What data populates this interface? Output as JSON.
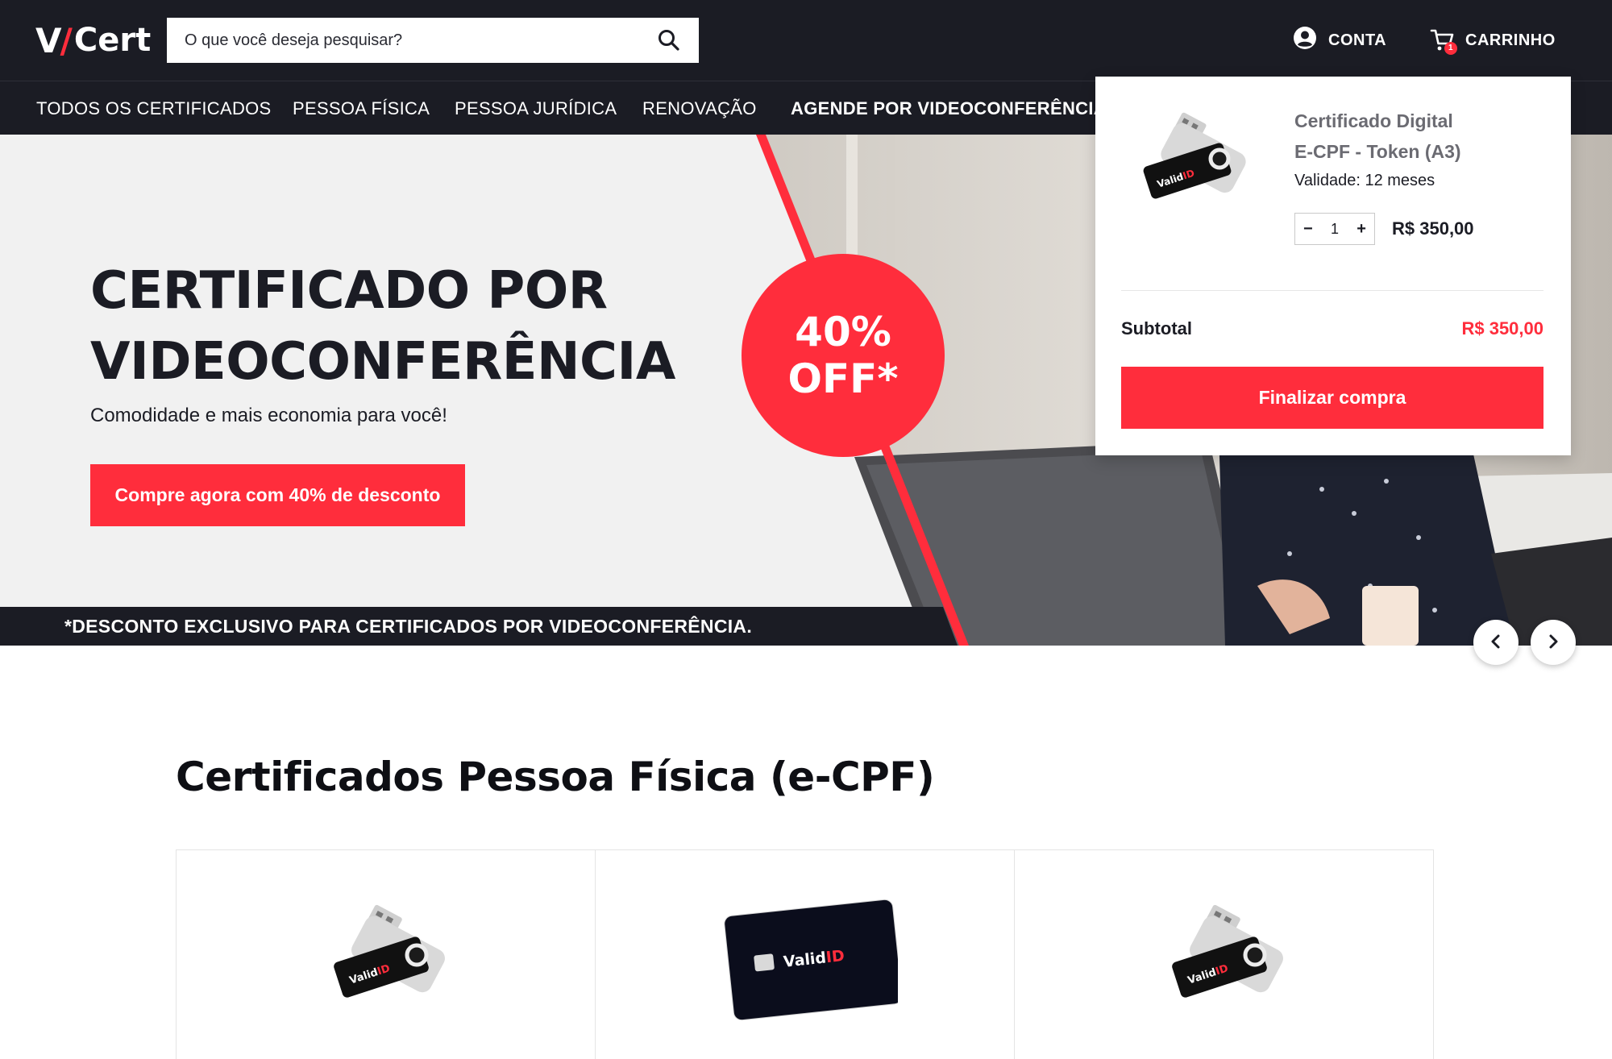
{
  "header": {
    "logo": {
      "v": "V",
      "slash": "/",
      "cert": "Cert"
    },
    "search": {
      "placeholder": "O que você deseja pesquisar?",
      "icon": "search-icon"
    },
    "account_label": "CONTA",
    "cart_label": "CARRINHO",
    "cart_count": "1"
  },
  "nav": {
    "items": [
      {
        "label": "TODOS OS CERTIFICADOS"
      },
      {
        "label": "PESSOA FÍSICA"
      },
      {
        "label": "PESSOA JURÍDICA"
      },
      {
        "label": "RENOVAÇÃO"
      },
      {
        "label": "AGENDE POR VIDEOCONFERÊNCIA"
      }
    ]
  },
  "hero": {
    "title_line1": "CERTIFICADO POR",
    "title_line2": "VIDEOCONFERÊNCIA",
    "subtitle": "Comodidade e mais economia para você!",
    "cta": "Compre agora com 40% de desconto",
    "badge_line1": "40%",
    "badge_line2": "OFF*",
    "disclaimer": "*DESCONTO EXCLUSIVO PARA CERTIFICADOS POR VIDEOCONFERÊNCIA."
  },
  "carousel": {
    "prev_icon": "chevron-left-icon",
    "next_icon": "chevron-right-icon"
  },
  "section": {
    "title": "Certificados Pessoa Física (e-CPF)"
  },
  "cart_dropdown": {
    "product_name_line1": "Certificado Digital",
    "product_name_line2": "E-CPF - Token (A3)",
    "validity": "Validade: 12 meses",
    "quantity": "1",
    "price": "R$ 350,00",
    "subtotal_label": "Subtotal",
    "subtotal_value": "R$ 350,00",
    "checkout_label": "Finalizar compra"
  },
  "product_images": {
    "token_brand": "ValidID",
    "card_brand": "ValidID"
  },
  "colors": {
    "accent": "#ff2d3c",
    "dark": "#1b1c24",
    "hero_bg": "#f1f1f1"
  }
}
